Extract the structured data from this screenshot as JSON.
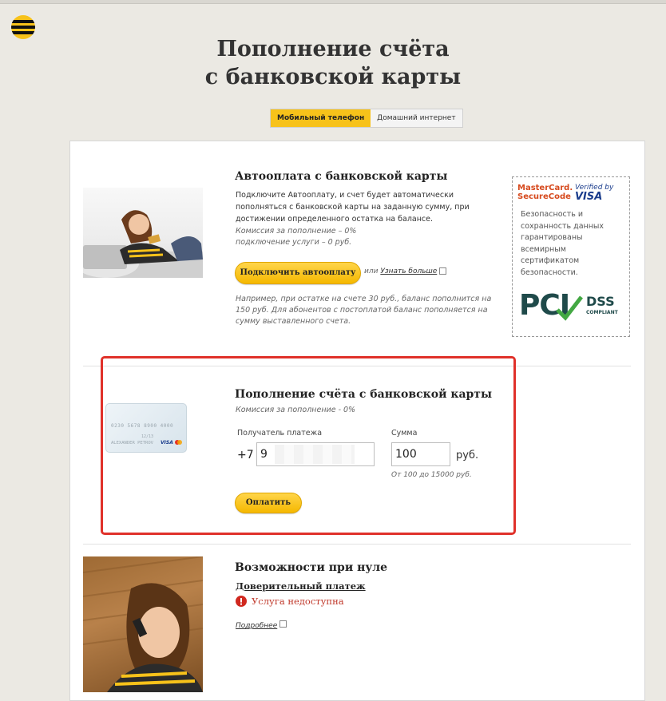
{
  "page": {
    "title_line1": "Пополнение счёта",
    "title_line2": "с банковской карты"
  },
  "tabs": [
    {
      "label": "Мобильный телефон",
      "active": true
    },
    {
      "label": "Домашний интернет",
      "active": false
    }
  ],
  "autopay": {
    "heading": "Автооплата с банковской карты",
    "description": "Подключите Автооплату, и счет будет автоматически пополняться с банковской карты на заданную сумму, при достижении определенного остатка на балансе.",
    "commission_line1": "Комиссия за пополнение – 0%",
    "commission_line2": "подключение услуги – 0 руб.",
    "button_label": "Подключить автооплату",
    "or_text": "или",
    "learn_more": "Узнать больше",
    "example": "Например, при остатке на счете 30 руб., баланс пополнится на 150 руб. Для абонентов с постоплатой баланс пополняется на сумму выставленного счета."
  },
  "security": {
    "mastercard": "MasterCard. SecureCode",
    "verified_line1": "Verified by",
    "verified_line2": "VISA",
    "text": "Безопасность и сохранность данных гарантированы всемирным сертификатом безопасности.",
    "pci_logo": "PCI",
    "dss": "DSS",
    "compliant": "COMPLIANT"
  },
  "topup": {
    "heading": "Пополнение счёта с банковской карты",
    "commission": "Комиссия за пополнение - 0%",
    "recipient_label": "Получатель платежа",
    "phone_prefix": "+7",
    "phone_value": "9",
    "amount_label": "Сумма",
    "amount_value": "100",
    "currency": "руб.",
    "range_note": "От 100 до 15000 руб.",
    "pay_button": "Оплатить",
    "card_number": "0230 5678 8900 4000",
    "card_holder": "ALEXANDER PETROV",
    "card_date": "12/13"
  },
  "zero": {
    "heading": "Возможности при нуле",
    "subheading": "Доверительный платеж",
    "status": "Услуга недоступна",
    "more_link": "Подробнее"
  },
  "colors": {
    "accent": "#f7c21a",
    "alert_red": "#e0312a",
    "error_text": "#c0392b"
  }
}
